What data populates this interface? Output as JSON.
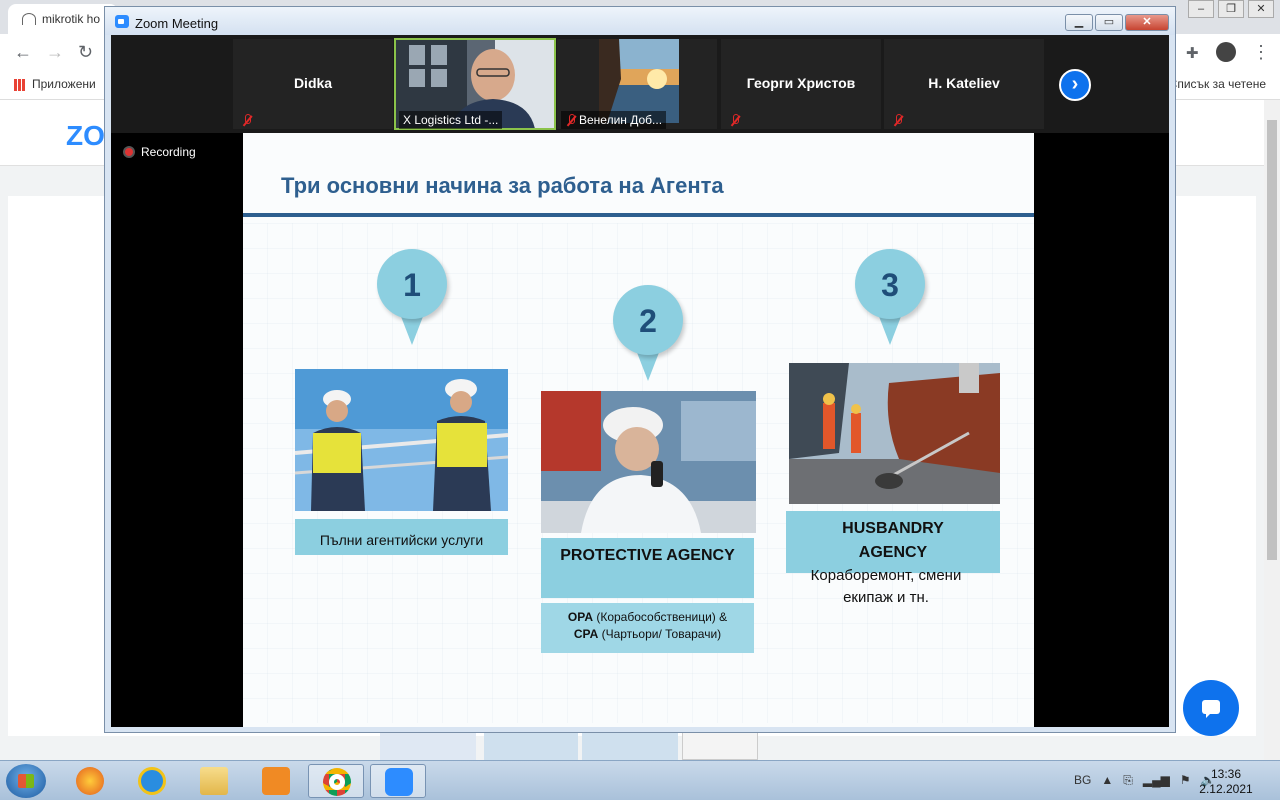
{
  "browser": {
    "tab_title": "mikrotik ho",
    "bookmarks_apps": "Приложени",
    "bookmarks_reading": "Списък за четене",
    "bg_logo": "ZO"
  },
  "zoom": {
    "window_title": "Zoom Meeting",
    "recording_label": "Recording",
    "participants": [
      {
        "name": "Didka",
        "muted": true,
        "video": false
      },
      {
        "name": "X Logistics Ltd -...",
        "muted": false,
        "video": true,
        "active": true
      },
      {
        "name": "Венелин Доб...",
        "muted": true,
        "video": true
      },
      {
        "name": "Георги Христов",
        "muted": true,
        "video": false
      },
      {
        "name": "H. Kateliev",
        "muted": true,
        "video": false
      }
    ]
  },
  "slide": {
    "title": "Три основни начина за работа на Агента",
    "items": [
      {
        "number": "1",
        "label": "Пълни агентийски услуги"
      },
      {
        "number": "2",
        "label": "PROTECTIVE AGENCY",
        "detail_line1_bold": "OPA",
        "detail_line1": " (Корабособственици) &",
        "detail_line2_bold": "CPA",
        "detail_line2": " (Чартьори/ Товарачи)"
      },
      {
        "number": "3",
        "label_line1": "HUSBANDRY",
        "label_line2": "AGENCY",
        "caption_line1": "Кораборемонт, смени",
        "caption_line2": "екипаж и тн."
      }
    ]
  },
  "taskbar": {
    "language": "BG",
    "time": "13:36",
    "date": "2.12.2021 г."
  },
  "colors": {
    "accent_blue": "#2e5f8f",
    "pin_blue": "#8ccfe0",
    "zoom_blue": "#0e72ed"
  }
}
